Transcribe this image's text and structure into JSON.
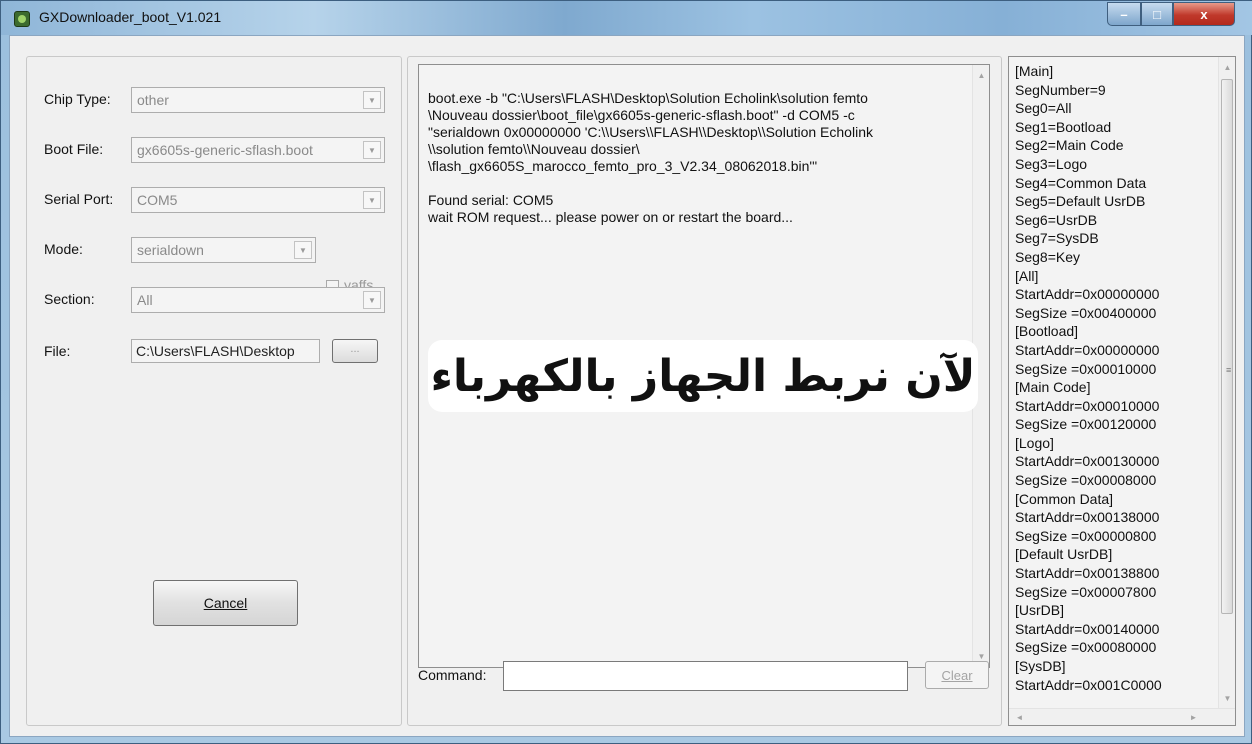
{
  "window": {
    "title": "GXDownloader_boot_V1.021",
    "minimize_glyph": "–",
    "maximize_glyph": "□",
    "close_glyph": "x"
  },
  "settings": {
    "chip_type_label": "Chip Type:",
    "chip_type_value": "other",
    "boot_file_label": "Boot File:",
    "boot_file_value": "gx6605s-generic-sflash.boot",
    "serial_port_label": "Serial Port:",
    "serial_port_value": "COM5",
    "mode_label": "Mode:",
    "mode_value": "serialdown",
    "yaffs_label": "yaffs",
    "section_label": "Section:",
    "section_value": "All",
    "file_label": "File:",
    "file_value": "C:\\Users\\FLASH\\Desktop",
    "browse_label": "...",
    "cancel_label": "Cancel"
  },
  "log": {
    "text": "boot.exe -b \"C:\\Users\\FLASH\\Desktop\\Solution Echolink\\solution femto\n\\Nouveau dossier\\boot_file\\gx6605s-generic-sflash.boot\" -d COM5 -c\n\"serialdown 0x00000000 'C:\\\\Users\\\\FLASH\\\\Desktop\\\\Solution Echolink\n\\\\solution femto\\\\Nouveau dossier\\\n\\flash_gx6605S_marocco_femto_pro_3_V2.34_08062018.bin'\"\n\nFound serial: COM5\nwait ROM request... please power on or restart the board...",
    "overlay_text": "لآن نربط الجهاز بالكهرباء"
  },
  "command": {
    "label": "Command:",
    "value": "",
    "clear_label": "Clear"
  },
  "ini_lines": [
    "[Main]",
    "SegNumber=9",
    "Seg0=All",
    "Seg1=Bootload",
    "Seg2=Main Code",
    "Seg3=Logo",
    "Seg4=Common Data",
    "Seg5=Default UsrDB",
    "Seg6=UsrDB",
    "Seg7=SysDB",
    "Seg8=Key",
    "[All]",
    "StartAddr=0x00000000",
    "SegSize  =0x00400000",
    "[Bootload]",
    "StartAddr=0x00000000",
    "SegSize  =0x00010000",
    "[Main Code]",
    "StartAddr=0x00010000",
    "SegSize  =0x00120000",
    "[Logo]",
    "StartAddr=0x00130000",
    "SegSize  =0x00008000",
    "[Common Data]",
    "StartAddr=0x00138000",
    "SegSize  =0x00000800",
    "[Default UsrDB]",
    "StartAddr=0x00138800",
    "SegSize  =0x00007800",
    "[UsrDB]",
    "StartAddr=0x00140000",
    "SegSize  =0x00080000",
    "[SysDB]",
    "StartAddr=0x001C0000"
  ]
}
